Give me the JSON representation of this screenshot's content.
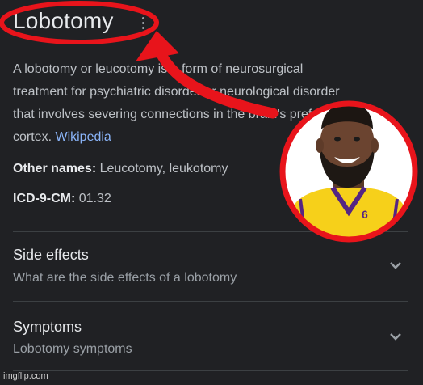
{
  "header": {
    "title": "Lobotomy"
  },
  "description": {
    "lines": [
      "A lobotomy or leucotomy is a form of neurosurgical",
      "treatment for psychiatric disorder or neurological disorder",
      "that involves severing connections in the brain's prefrontal"
    ],
    "last_line_prefix": "cortex. ",
    "source_link": "Wikipedia"
  },
  "facts": [
    {
      "label": "Other names:",
      "value": "Leucotomy, leukotomy"
    },
    {
      "label": "ICD-9-CM:",
      "value": "01.32"
    }
  ],
  "accordion": [
    {
      "title": "Side effects",
      "subtitle": "What are the side effects of a lobotomy"
    },
    {
      "title": "Symptoms",
      "subtitle": "Lobotomy symptoms"
    }
  ],
  "overlay": {
    "annotation_color": "#e8141b",
    "jersey_number": "6"
  },
  "watermark": "imgflip.com",
  "colors": {
    "background": "#202124",
    "text_primary": "#e8eaed",
    "text_secondary": "#bdc1c6",
    "link": "#8ab4f8",
    "annotation_red": "#e8141b",
    "jersey_gold": "#f6d01a",
    "jersey_purple": "#552583"
  }
}
